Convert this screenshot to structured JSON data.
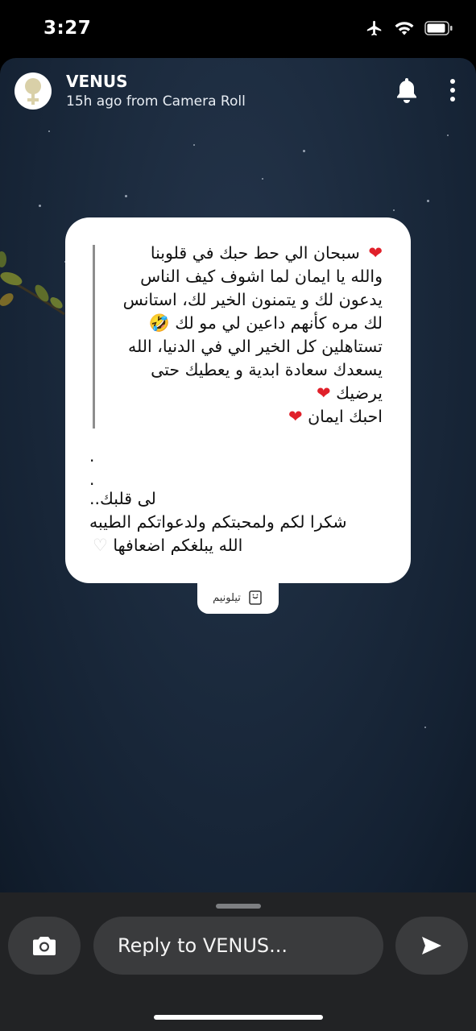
{
  "status_bar": {
    "time": "3:27",
    "icons": [
      "airplane-icon",
      "wifi-icon",
      "battery-icon"
    ]
  },
  "header": {
    "name": "VENUS",
    "subtitle": "15h ago from Camera Roll",
    "avatar_icon": "venus-symbol-icon",
    "actions": [
      "bell-icon",
      "more-vertical-icon"
    ]
  },
  "card": {
    "quote_lines": [
      "سبحان الي حط حبك في قلوبنا",
      "والله يا ايمان لما اشوف كيف الناس",
      "يدعون لك و يتمنون الخير لك، استانس",
      "لك مره كأنهم داعين لي مو لك",
      "تستاهلين كل الخير الي في الدنيا، الله",
      "يسعدك سعادة ابدية و يعطيك حتى",
      "يرضيك",
      "احبك ايمان"
    ],
    "emoji": {
      "red_heart": "❤",
      "laughing": "🤣",
      "white_heart": "♡"
    },
    "dots": [
      ".",
      "."
    ],
    "thanks_lines": [
      "لى قلبك..",
      "شكرا لكم ولمحبتكم ولدعواتكم الطيبه",
      "الله يبلغكم اضعافها"
    ]
  },
  "sticker": {
    "label": "تيلونيم"
  },
  "bottom_bar": {
    "reply_placeholder": "Reply to VENUS...",
    "camera_icon": "camera-icon",
    "send_icon": "send-icon"
  },
  "colors": {
    "background_top": "#24344a",
    "background_bottom": "#0f1a28",
    "card": "#ffffff",
    "bottom_bar": "#222325",
    "button": "#3a3b3d",
    "heart": "#e0202a"
  }
}
